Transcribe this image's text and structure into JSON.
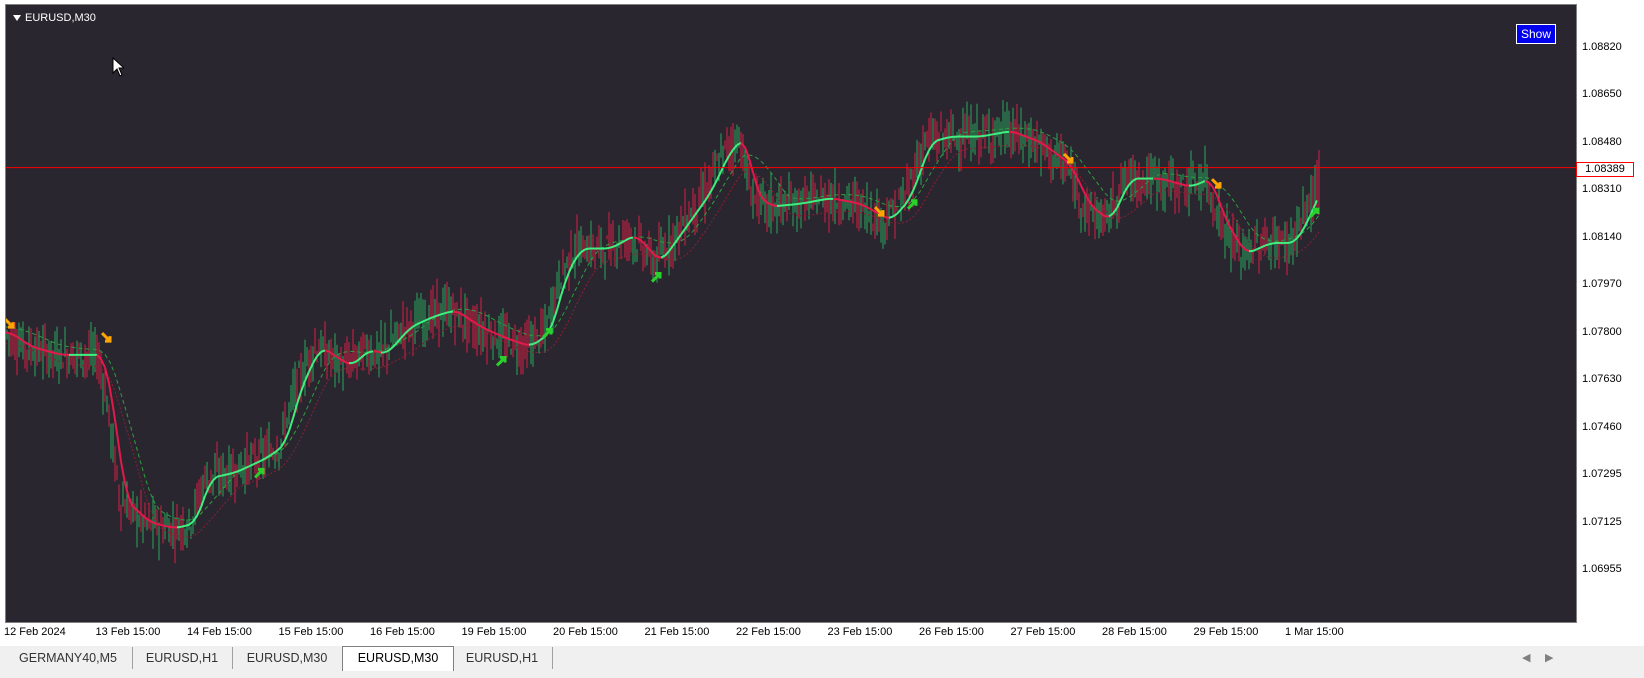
{
  "chart": {
    "symbol_title": "EURUSD,M30",
    "show_button_label": "Show",
    "current_price": "1.08389",
    "colors": {
      "background": "#2a2630",
      "bull_candle": "#26a65b",
      "bear_candle": "#d61e44",
      "trend_up": "#3ff07f",
      "trend_down": "#e3194a",
      "signal_buy": "#2bd12b",
      "signal_sell": "#ffa500",
      "price_line": "#ff0000"
    },
    "price_axis": [
      "1.08820",
      "1.08650",
      "1.08480",
      "1.08310",
      "1.08140",
      "1.07970",
      "1.07800",
      "1.07630",
      "1.07460",
      "1.07295",
      "1.07125",
      "1.06955"
    ],
    "time_axis": [
      "12 Feb 2024",
      "13 Feb 15:00",
      "14 Feb 15:00",
      "15 Feb 15:00",
      "16 Feb 15:00",
      "19 Feb 15:00",
      "20 Feb 15:00",
      "21 Feb 15:00",
      "22 Feb 15:00",
      "23 Feb 15:00",
      "26 Feb 15:00",
      "27 Feb 15:00",
      "28 Feb 15:00",
      "29 Feb 15:00",
      "1 Mar 15:00"
    ],
    "series_anchors": [
      [
        0,
        1.078
      ],
      [
        20,
        1.0775
      ],
      [
        50,
        1.0772
      ],
      [
        92,
        1.0772
      ],
      [
        100,
        1.076
      ],
      [
        115,
        1.072
      ],
      [
        140,
        1.0712
      ],
      [
        165,
        1.071
      ],
      [
        185,
        1.0712
      ],
      [
        200,
        1.0728
      ],
      [
        225,
        1.073
      ],
      [
        255,
        1.0735
      ],
      [
        275,
        1.074
      ],
      [
        290,
        1.076
      ],
      [
        310,
        1.0775
      ],
      [
        340,
        1.0768
      ],
      [
        360,
        1.0774
      ],
      [
        375,
        1.0772
      ],
      [
        400,
        1.0782
      ],
      [
        425,
        1.0786
      ],
      [
        445,
        1.0788
      ],
      [
        470,
        1.0782
      ],
      [
        495,
        1.0778
      ],
      [
        520,
        1.0775
      ],
      [
        540,
        1.078
      ],
      [
        555,
        1.08
      ],
      [
        570,
        1.081
      ],
      [
        600,
        1.081
      ],
      [
        625,
        1.0815
      ],
      [
        650,
        1.0805
      ],
      [
        680,
        1.082
      ],
      [
        700,
        1.083
      ],
      [
        720,
        1.0845
      ],
      [
        735,
        1.085
      ],
      [
        745,
        1.083
      ],
      [
        760,
        1.0825
      ],
      [
        790,
        1.0826
      ],
      [
        820,
        1.0828
      ],
      [
        850,
        1.0826
      ],
      [
        880,
        1.082
      ],
      [
        900,
        1.0828
      ],
      [
        920,
        1.0848
      ],
      [
        940,
        1.085
      ],
      [
        970,
        1.085
      ],
      [
        1000,
        1.0852
      ],
      [
        1030,
        1.0848
      ],
      [
        1060,
        1.084
      ],
      [
        1080,
        1.0825
      ],
      [
        1100,
        1.082
      ],
      [
        1120,
        1.0835
      ],
      [
        1150,
        1.0835
      ],
      [
        1180,
        1.0832
      ],
      [
        1200,
        1.0835
      ],
      [
        1215,
        1.082
      ],
      [
        1235,
        1.0808
      ],
      [
        1260,
        1.0812
      ],
      [
        1285,
        1.0812
      ],
      [
        1300,
        1.0822
      ],
      [
        1315,
        1.0835
      ]
    ],
    "buy_signals": [
      [
        255,
        1.073
      ],
      [
        497,
        1.077
      ],
      [
        543,
        1.078
      ],
      [
        652,
        1.08
      ],
      [
        908,
        1.0826
      ],
      [
        1310,
        1.0823
      ]
    ],
    "sell_signals": [
      [
        5,
        1.0783
      ],
      [
        102,
        1.0778
      ],
      [
        875,
        1.0823
      ],
      [
        1064,
        1.0842
      ],
      [
        1212,
        1.0833
      ]
    ]
  },
  "tabs": {
    "items": [
      {
        "label": "GERMANY40,M5"
      },
      {
        "label": "EURUSD,H1"
      },
      {
        "label": "EURUSD,M30"
      },
      {
        "label": "EURUSD,M30"
      },
      {
        "label": "EURUSD,H1"
      }
    ],
    "active_index": 3,
    "scroll_left": "◀",
    "scroll_right": "▶"
  }
}
